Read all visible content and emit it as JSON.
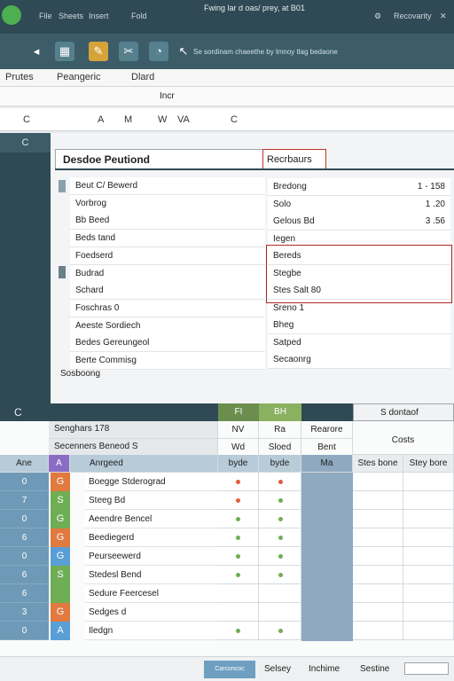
{
  "titlebar": {
    "menu": [
      "File",
      "Sheets",
      "Insert",
      "Fold"
    ],
    "title": "Fwing lar d oas/ prey, at B01",
    "right_link": "Recovarity"
  },
  "ribbon": {
    "description": "Se sordinam chaeethe by lmnoy tlag bedaone"
  },
  "tabs": {
    "items": [
      "Prutes",
      "Peangeric",
      "Dlard"
    ]
  },
  "subtabs": {
    "label": "Incr"
  },
  "formula": {
    "cells": [
      "C",
      "A",
      "M",
      "W",
      "VA",
      "C"
    ]
  },
  "leftpanel": {
    "head": "C"
  },
  "panelA": {
    "title": "Desdoe Peutiond"
  },
  "panelB": {
    "title": "Recrbaurs"
  },
  "left_rows": [
    "Beut C/ Bewerd",
    "Vorbrog",
    "Bb Beed",
    "Beds tand",
    "Foedserd",
    "Budrad",
    "Schard",
    "Foschras 0",
    "Aeeste Sordiech",
    "Bedes Gereungeol",
    "Berte Commisg"
  ],
  "right_rows": [
    {
      "label": "Bredong",
      "value": "1 - 158"
    },
    {
      "label": "Solo",
      "value": "1 .20"
    },
    {
      "label": "Gelous Bd",
      "value": "3 .56"
    },
    {
      "label": "Iegen",
      "value": ""
    },
    {
      "label": "Bereds",
      "value": ""
    },
    {
      "label": "Stegbe",
      "value": ""
    },
    {
      "label": "Stes Salt 80",
      "value": ""
    },
    {
      "label": "Sreno 1",
      "value": ""
    },
    {
      "label": "Bheg",
      "value": ""
    },
    {
      "label": "Satped",
      "value": ""
    },
    {
      "label": "Secaonrg",
      "value": ""
    }
  ],
  "footnote": "Sosboong",
  "lower": {
    "head_c": "C",
    "col_f": "FI",
    "col_bh": "BH",
    "sub1": "Senghars 178",
    "sub1b": "NV",
    "sub1c": "Ra",
    "sub2": "Secenners Beneod S",
    "sub2b": "Wd",
    "sub2c": "Sloed",
    "required": "Rearore",
    "required2": "Bent",
    "search_box": "S dontaof",
    "col_costs": "Costs",
    "header_labels": [
      "Ane",
      "A",
      "Anrgeed",
      "byde",
      "byde",
      "Ma",
      "Stes bone",
      "Stey bore"
    ],
    "rows": [
      {
        "num": "0",
        "badge": "G",
        "badge_color": "#e07a3e",
        "name": "Boegge Stderograd",
        "d1": "#e05d3b",
        "d2": "#e05d3b"
      },
      {
        "num": "7",
        "badge": "S",
        "badge_color": "#6fae54",
        "name": "Steeg Bd",
        "d1": "#e05d3b",
        "d2": "#6fae54"
      },
      {
        "num": "0",
        "badge": "G",
        "badge_color": "#6fae54",
        "name": "Aeendre Bencel",
        "d1": "#6fae54",
        "d2": "#6fae54"
      },
      {
        "num": "6",
        "badge": "G",
        "badge_color": "#e07a3e",
        "name": "Beediegerd",
        "d1": "#6fae54",
        "d2": "#6fae54"
      },
      {
        "num": "0",
        "badge": "G",
        "badge_color": "#5a9ed6",
        "name": "Peurseewerd",
        "d1": "#6fae54",
        "d2": "#6fae54"
      },
      {
        "num": "6",
        "badge": "S",
        "badge_color": "#6fae54",
        "name": "Stedesl Bend",
        "d1": "#6fae54",
        "d2": "#6fae54"
      },
      {
        "num": "6",
        "badge": "",
        "badge_color": "#6fae54",
        "name": "Sedure Feercesel",
        "d1": "",
        "d2": ""
      },
      {
        "num": "3",
        "badge": "G",
        "badge_color": "#e07a3e",
        "name": "Sedges d",
        "d1": "",
        "d2": ""
      },
      {
        "num": "0",
        "badge": "A",
        "badge_color": "#5a9ed6",
        "name": "Iledgn",
        "d1": "#6fae54",
        "d2": "#6fae54"
      }
    ]
  },
  "status": {
    "items": [
      "Carconcoc",
      "Selsey",
      "Inchime",
      "Sestine"
    ]
  }
}
